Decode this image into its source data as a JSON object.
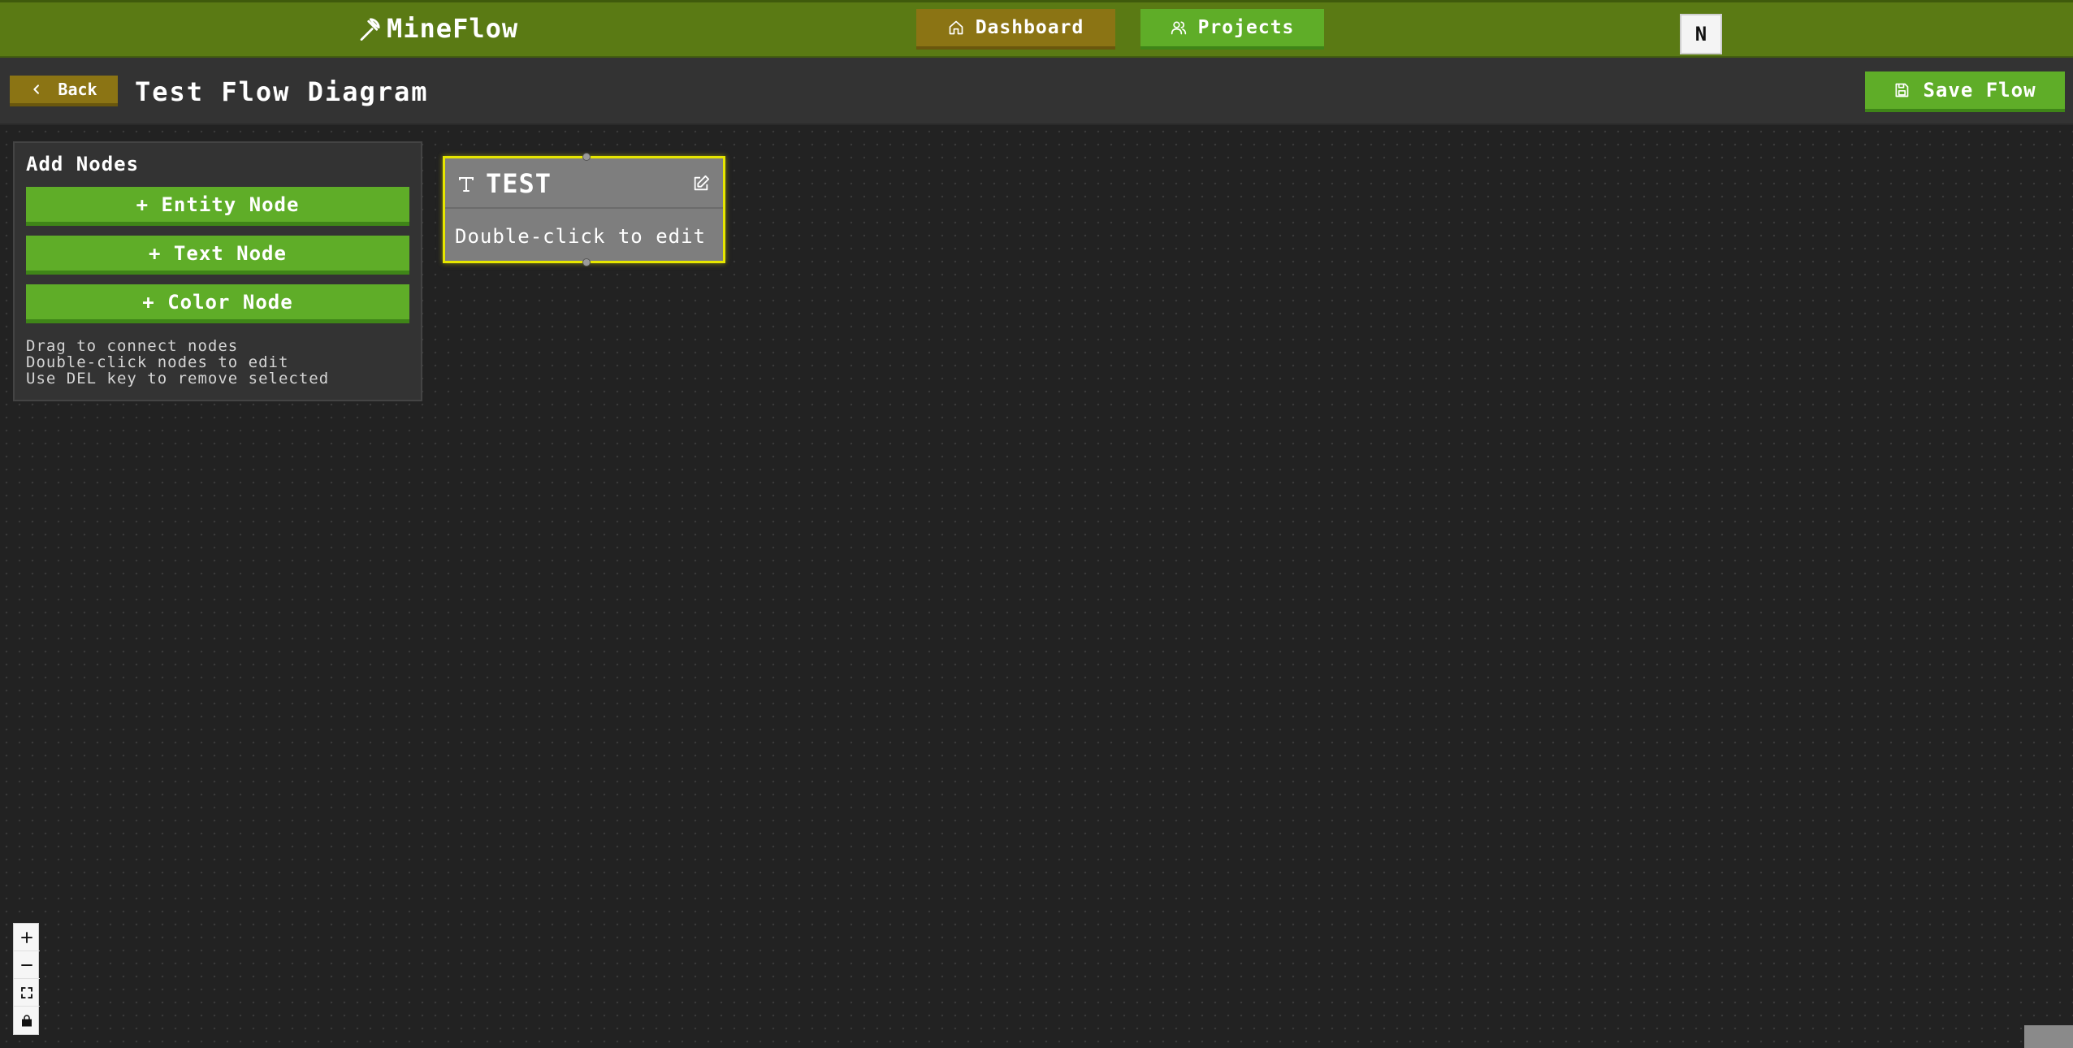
{
  "nav": {
    "logo": "MineFlow",
    "dashboard_label": "Dashboard",
    "projects_label": "Projects",
    "avatar_initial": "N"
  },
  "header": {
    "back_label": "Back",
    "title": "Test Flow Diagram",
    "save_label": "Save Flow"
  },
  "panel": {
    "title": "Add Nodes",
    "buttons": [
      {
        "label": "+ Entity Node"
      },
      {
        "label": "+ Text Node"
      },
      {
        "label": "+ Color Node"
      }
    ],
    "help_lines": [
      "Drag to connect nodes",
      "Double-click nodes to edit",
      "Use DEL key to remove selected"
    ]
  },
  "node": {
    "title": "TEST",
    "body": "Double-click to edit",
    "type_icon": "text-type-icon"
  },
  "controls": [
    "zoom-in-icon",
    "zoom-out-icon",
    "fit-view-icon",
    "lock-icon"
  ],
  "colors": {
    "nav_bg": "#5a7a14",
    "accent_green": "#5fad28",
    "accent_gold": "#8b7414",
    "canvas_bg": "#222222",
    "selection": "#e6e600"
  }
}
